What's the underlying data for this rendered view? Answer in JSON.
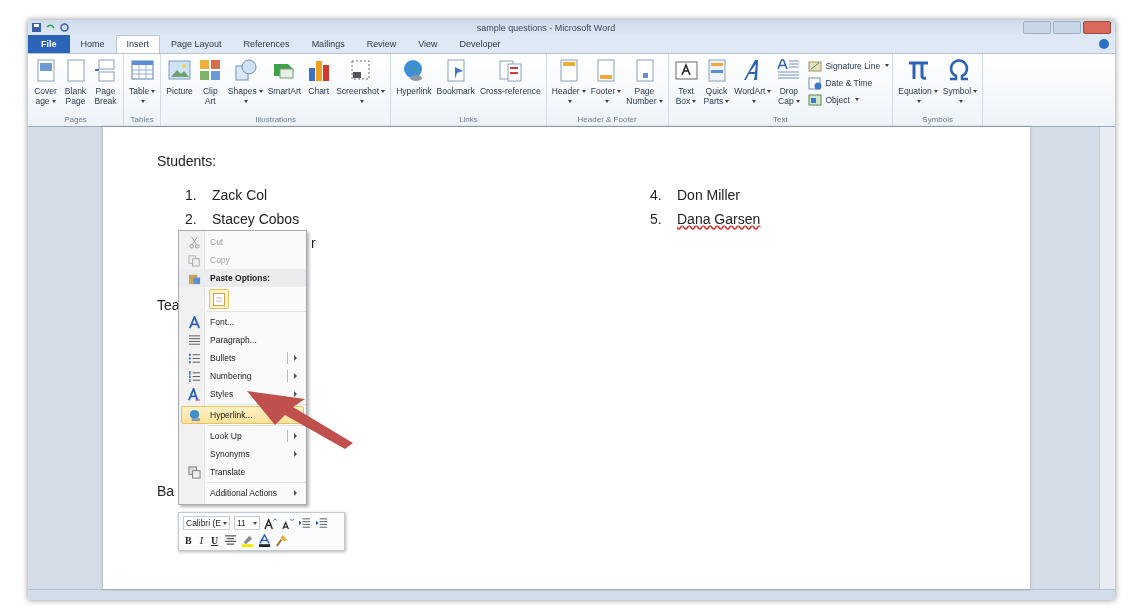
{
  "window": {
    "title": "sample questions - Microsoft Word"
  },
  "tabs": [
    {
      "label": "File",
      "kind": "file",
      "selected": false
    },
    {
      "label": "Home",
      "kind": "tab",
      "selected": false
    },
    {
      "label": "Insert",
      "kind": "tab",
      "selected": true
    },
    {
      "label": "Page Layout",
      "kind": "tab",
      "selected": false
    },
    {
      "label": "References",
      "kind": "tab",
      "selected": false
    },
    {
      "label": "Mailings",
      "kind": "tab",
      "selected": false
    },
    {
      "label": "Review",
      "kind": "tab",
      "selected": false
    },
    {
      "label": "View",
      "kind": "tab",
      "selected": false
    },
    {
      "label": "Developer",
      "kind": "tab",
      "selected": false
    }
  ],
  "ribbon": {
    "groups": [
      {
        "label": "Pages",
        "buttons": [
          {
            "lines": [
              "Cover",
              "age"
            ],
            "dropdown": true
          },
          {
            "lines": [
              "Blank",
              "Page"
            ],
            "dropdown": false
          },
          {
            "lines": [
              "Page",
              "Break"
            ],
            "dropdown": false
          }
        ]
      },
      {
        "label": "Tables",
        "buttons": [
          {
            "lines": [
              "Table"
            ],
            "dropdown": true
          }
        ]
      },
      {
        "label": "Illustrations",
        "buttons": [
          {
            "lines": [
              "Picture"
            ],
            "dropdown": false
          },
          {
            "lines": [
              "Clip",
              "Art"
            ],
            "dropdown": false
          },
          {
            "lines": [
              "Shapes"
            ],
            "dropdown": true
          },
          {
            "lines": [
              "SmartArt"
            ],
            "dropdown": false
          },
          {
            "lines": [
              "Chart"
            ],
            "dropdown": false
          },
          {
            "lines": [
              "Screenshot"
            ],
            "dropdown": true
          }
        ]
      },
      {
        "label": "Links",
        "buttons": [
          {
            "lines": [
              "Hyperlink"
            ],
            "dropdown": false
          },
          {
            "lines": [
              "Bookmark"
            ],
            "dropdown": false
          },
          {
            "lines": [
              "Cross-reference"
            ],
            "dropdown": false
          }
        ]
      },
      {
        "label": "Header & Footer",
        "buttons": [
          {
            "lines": [
              "Header"
            ],
            "dropdown": true
          },
          {
            "lines": [
              "Footer"
            ],
            "dropdown": true
          },
          {
            "lines": [
              "Page",
              "Number"
            ],
            "dropdown": true
          }
        ]
      },
      {
        "label": "Text",
        "buttons": [
          {
            "lines": [
              "Text",
              "Box"
            ],
            "dropdown": true
          },
          {
            "lines": [
              "Quick",
              "Parts"
            ],
            "dropdown": true
          },
          {
            "lines": [
              "WordArt"
            ],
            "dropdown": true
          },
          {
            "lines": [
              "Drop",
              "Cap"
            ],
            "dropdown": true
          }
        ],
        "small_buttons": [
          {
            "label": "Signature Line",
            "dropdown": true
          },
          {
            "label": "Date & Time",
            "dropdown": false
          },
          {
            "label": "Object",
            "dropdown": true
          }
        ]
      },
      {
        "label": "Symbols",
        "buttons": [
          {
            "lines": [
              "Equation"
            ],
            "dropdown": true
          },
          {
            "lines": [
              "Symbol"
            ],
            "dropdown": true
          }
        ]
      }
    ]
  },
  "document": {
    "heading": "Students:",
    "list_left": [
      {
        "number": "1.",
        "name": "Zack Col"
      },
      {
        "number": "2.",
        "name": "Stacey Cobos"
      }
    ],
    "list_left_fragment": "r",
    "list_right": [
      {
        "number": "4.",
        "name": "Don Miller"
      },
      {
        "number": "5.",
        "name": "Dana Garsen",
        "misspelled": true
      }
    ],
    "fragments": [
      "Tea",
      "Ba"
    ]
  },
  "context_menu": {
    "items": [
      {
        "kind": "item",
        "label": "Cut",
        "disabled": true,
        "selected": false,
        "submenu": false,
        "split": false
      },
      {
        "kind": "item",
        "label": "Copy",
        "disabled": true,
        "selected": false,
        "submenu": false,
        "split": false
      },
      {
        "kind": "header",
        "label": "Paste Options:"
      },
      {
        "kind": "paste"
      },
      {
        "kind": "separator"
      },
      {
        "kind": "item",
        "label": "Font...",
        "disabled": false,
        "selected": false,
        "submenu": false,
        "split": false
      },
      {
        "kind": "item",
        "label": "Paragraph...",
        "disabled": false,
        "selected": false,
        "submenu": false,
        "split": false
      },
      {
        "kind": "item",
        "label": "Bullets",
        "disabled": false,
        "selected": false,
        "submenu": true,
        "split": true
      },
      {
        "kind": "item",
        "label": "Numbering",
        "disabled": false,
        "selected": false,
        "submenu": true,
        "split": true
      },
      {
        "kind": "item",
        "label": "Styles",
        "disabled": false,
        "selected": false,
        "submenu": true,
        "split": false
      },
      {
        "kind": "separator"
      },
      {
        "kind": "item",
        "label": "Hyperlink...",
        "disabled": false,
        "selected": true,
        "submenu": false,
        "split": false
      },
      {
        "kind": "separator"
      },
      {
        "kind": "item",
        "label": "Look Up",
        "disabled": false,
        "selected": false,
        "submenu": true,
        "split": true
      },
      {
        "kind": "item",
        "label": "Synonyms",
        "disabled": false,
        "selected": false,
        "submenu": true,
        "split": false
      },
      {
        "kind": "item",
        "label": "Translate",
        "disabled": false,
        "selected": false,
        "submenu": false,
        "split": false
      },
      {
        "kind": "separator"
      },
      {
        "kind": "item",
        "label": "Additional Actions",
        "disabled": false,
        "selected": false,
        "submenu": true,
        "split": false
      }
    ]
  },
  "mini_toolbar": {
    "font": "Calibri (E",
    "size": "11",
    "row1": [
      {
        "kind": "icon"
      },
      {
        "kind": "icon"
      },
      {
        "kind": "icon"
      },
      {
        "kind": "icon"
      }
    ],
    "row2": [
      {
        "kind": "text",
        "label": "B"
      },
      {
        "kind": "text",
        "label": "I"
      },
      {
        "kind": "text",
        "label": "U"
      },
      {
        "kind": "icon"
      },
      {
        "kind": "icon"
      },
      {
        "kind": "icon"
      },
      {
        "kind": "icon"
      }
    ]
  }
}
